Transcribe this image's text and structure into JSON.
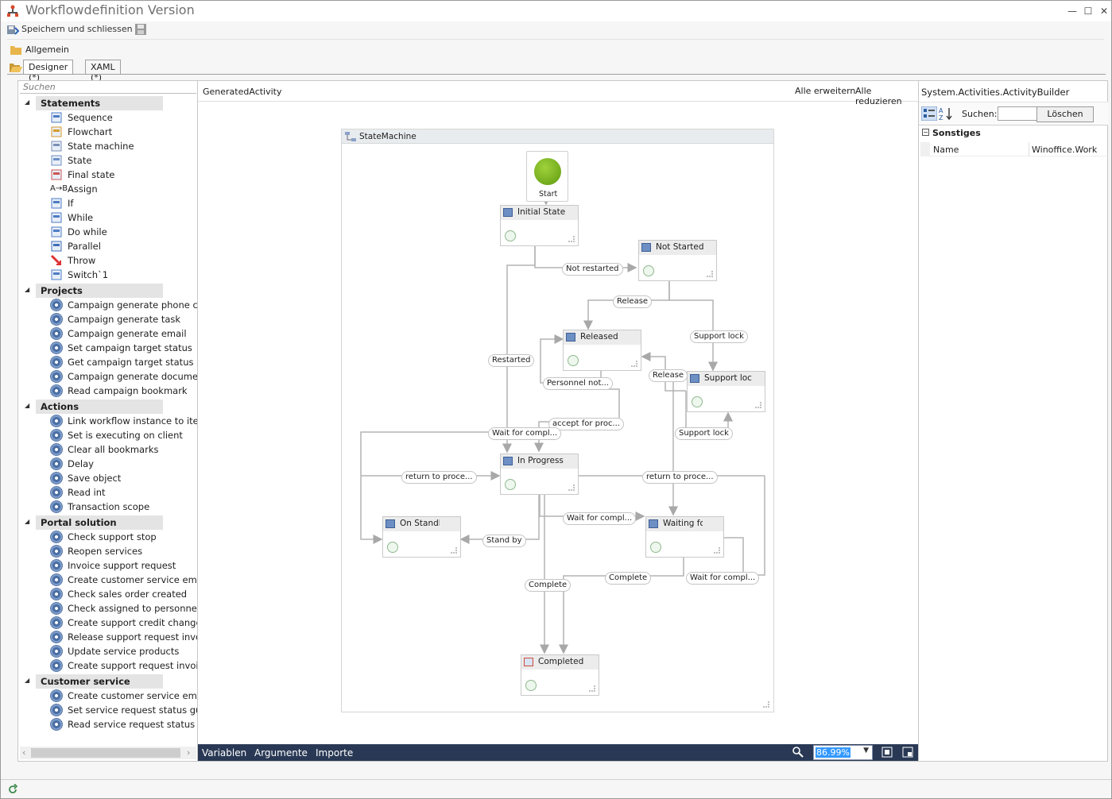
{
  "window": {
    "title": "Workflowdefinition Version",
    "min": "—",
    "max": "☐",
    "close": "✕"
  },
  "toolbar": {
    "save_close": "Speichern und schliessen"
  },
  "section": {
    "allgemein": "Allgemein"
  },
  "tabs": [
    {
      "label": "Designer (*)"
    },
    {
      "label": "XAML (*)"
    }
  ],
  "toolbox": {
    "search_placeholder": "Suchen",
    "categories": [
      {
        "label": "Statements",
        "items": [
          "Sequence",
          "Flowchart",
          "State machine",
          "State",
          "Final state",
          "Assign",
          "If",
          "While",
          "Do while",
          "Parallel",
          "Throw",
          "Switch`1"
        ]
      },
      {
        "label": "Projects",
        "items": [
          "Campaign generate phone call",
          "Campaign generate task",
          "Campaign generate email",
          "Set campaign target status",
          "Get campaign target status",
          "Campaign generate document",
          "Read campaign bookmark"
        ]
      },
      {
        "label": "Actions",
        "items": [
          "Link workflow instance to item",
          "Set is executing on client",
          "Clear all bookmarks",
          "Delay",
          "Save object",
          "Read int",
          "Transaction scope"
        ]
      },
      {
        "label": "Portal solution",
        "items": [
          "Check support stop",
          "Reopen services",
          "Invoice support request",
          "Create customer service email",
          "Check sales order created",
          "Check assigned to personnel",
          "Create support credit change noti",
          "Release support request invoices",
          "Update service products",
          "Create support request invoice er"
        ]
      },
      {
        "label": "Customer service",
        "items": [
          "Create customer service email",
          "Set service request status guid",
          "Read service request status"
        ]
      }
    ]
  },
  "designer": {
    "breadcrumb": "GeneratedActivity",
    "expand_all": "Alle erweitern",
    "collapse_all": "Alle reduzieren",
    "statemachine_title": "StateMachine",
    "start_label": "Start",
    "states": {
      "initial": "Initial State",
      "not_started": "Not Started",
      "released": "Released",
      "support_lock": "Support loc",
      "in_progress": "In Progress",
      "on_standby": "On Standby",
      "waiting": "Waiting for",
      "completed": "Completed"
    },
    "transitions": {
      "not_restarted": "Not restarted",
      "release1": "Release",
      "support_lock1": "Support lock",
      "restarted": "Restarted",
      "release2": "Release",
      "personnel": "Personnel not...",
      "accept": "accept for proc...",
      "wait1": "Wait for compl...",
      "support_lock2": "Support lock",
      "return1": "return to proce...",
      "return2": "return to proce...",
      "stand_by": "Stand by",
      "wait2": "Wait for compl...",
      "complete1": "Complete",
      "complete2": "Complete",
      "wait3": "Wait for compl..."
    },
    "status": {
      "variables": "Variablen",
      "arguments": "Argumente",
      "imports": "Importe",
      "zoom": "86.99%"
    }
  },
  "properties": {
    "header": "System.Activities.ActivityBuilder",
    "search_label": "Suchen:",
    "clear_button": "Löschen",
    "category": "Sonstiges",
    "rows": [
      {
        "name": "Name",
        "value": "Winoffice.Work"
      }
    ]
  }
}
